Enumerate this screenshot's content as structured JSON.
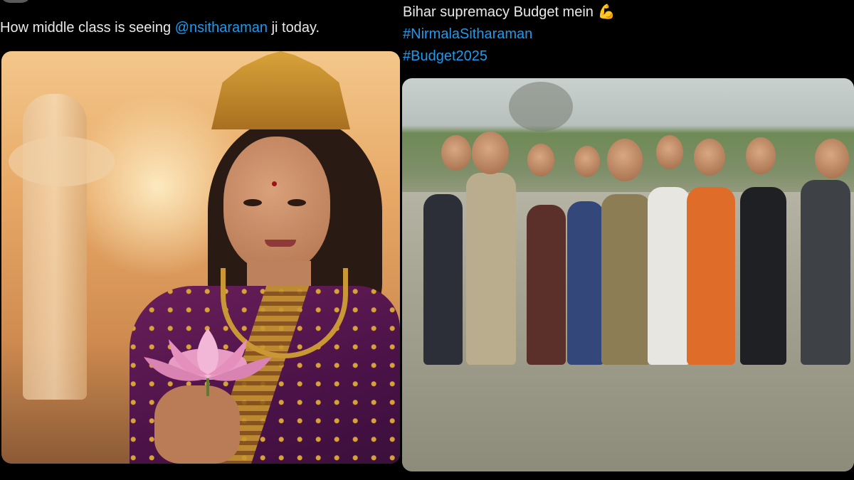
{
  "left_tweet": {
    "text_prefix": "How middle class is seeing ",
    "mention": "@nsitharaman",
    "text_suffix": " ji today."
  },
  "right_tweet": {
    "line1": "Bihar supremacy Budget mein",
    "emoji": "💪",
    "hashtag1": "#NirmalaSitharaman",
    "hashtag2": "#Budget2025"
  },
  "colors": {
    "background": "#000000",
    "text": "#e7e9ea",
    "link": "#1d9bf0"
  }
}
